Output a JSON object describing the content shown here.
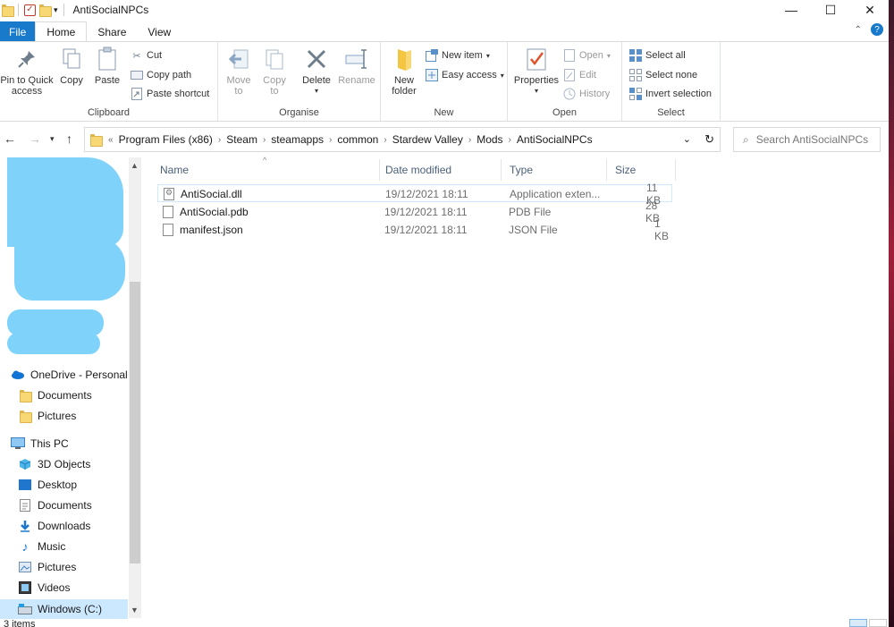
{
  "window": {
    "title": "AntiSocialNPCs",
    "minimize_glyph": "—",
    "maximize_glyph": "☐",
    "close_glyph": "✕"
  },
  "tabs": [
    {
      "label": "File"
    },
    {
      "label": "Home"
    },
    {
      "label": "Share"
    },
    {
      "label": "View"
    }
  ],
  "ribbon": {
    "clipboard": {
      "label": "Clipboard",
      "pin": "Pin to Quick access",
      "pin_l1": "Pin to Quick",
      "pin_l2": "access",
      "copy": "Copy",
      "paste": "Paste",
      "cut": "Cut",
      "copy_path": "Copy path",
      "paste_shortcut": "Paste shortcut"
    },
    "organise": {
      "label": "Organise",
      "move_l1": "Move",
      "move_l2": "to",
      "copy_l1": "Copy",
      "copy_l2": "to",
      "delete": "Delete",
      "rename": "Rename"
    },
    "new": {
      "label": "New",
      "folder_l1": "New",
      "folder_l2": "folder",
      "new_item": "New item",
      "easy_access": "Easy access"
    },
    "open": {
      "label": "Open",
      "properties": "Properties",
      "open": "Open",
      "edit": "Edit",
      "history": "History"
    },
    "select": {
      "label": "Select",
      "select_all": "Select all",
      "select_none": "Select none",
      "invert": "Invert selection"
    }
  },
  "address": {
    "overflow": "«",
    "crumbs": [
      "Program Files (x86)",
      "Steam",
      "steamapps",
      "common",
      "Stardew Valley",
      "Mods",
      "AntiSocialNPCs"
    ],
    "search_placeholder": "Search AntiSocialNPCs"
  },
  "navpane": {
    "items": [
      {
        "label": "OneDrive - Personal",
        "icon": "cloud-icon"
      },
      {
        "label": "Documents",
        "icon": "folder-icon"
      },
      {
        "label": "Pictures",
        "icon": "folder-icon"
      },
      {
        "label": "This PC",
        "icon": "computer-icon"
      },
      {
        "label": "3D Objects",
        "icon": "cube-icon"
      },
      {
        "label": "Desktop",
        "icon": "desktop-icon"
      },
      {
        "label": "Documents",
        "icon": "documents-icon"
      },
      {
        "label": "Downloads",
        "icon": "download-icon"
      },
      {
        "label": "Music",
        "icon": "music-icon"
      },
      {
        "label": "Pictures",
        "icon": "pictures-icon"
      },
      {
        "label": "Videos",
        "icon": "videos-icon"
      },
      {
        "label": "Windows (C:)",
        "icon": "drive-icon"
      }
    ]
  },
  "filelist": {
    "columns": {
      "name": "Name",
      "date": "Date modified",
      "type": "Type",
      "size": "Size"
    },
    "files": [
      {
        "name": "AntiSocial.dll",
        "date": "19/12/2021 18:11",
        "type": "Application exten...",
        "size": "11 KB"
      },
      {
        "name": "AntiSocial.pdb",
        "date": "19/12/2021 18:11",
        "type": "PDB File",
        "size": "28 KB"
      },
      {
        "name": "manifest.json",
        "date": "19/12/2021 18:11",
        "type": "JSON File",
        "size": "1 KB"
      }
    ]
  },
  "status": {
    "items_text": "3 items"
  },
  "colors": {
    "accent": "#1979ca",
    "selection": "#cce8ff",
    "redacted": "#7fd3fb"
  }
}
